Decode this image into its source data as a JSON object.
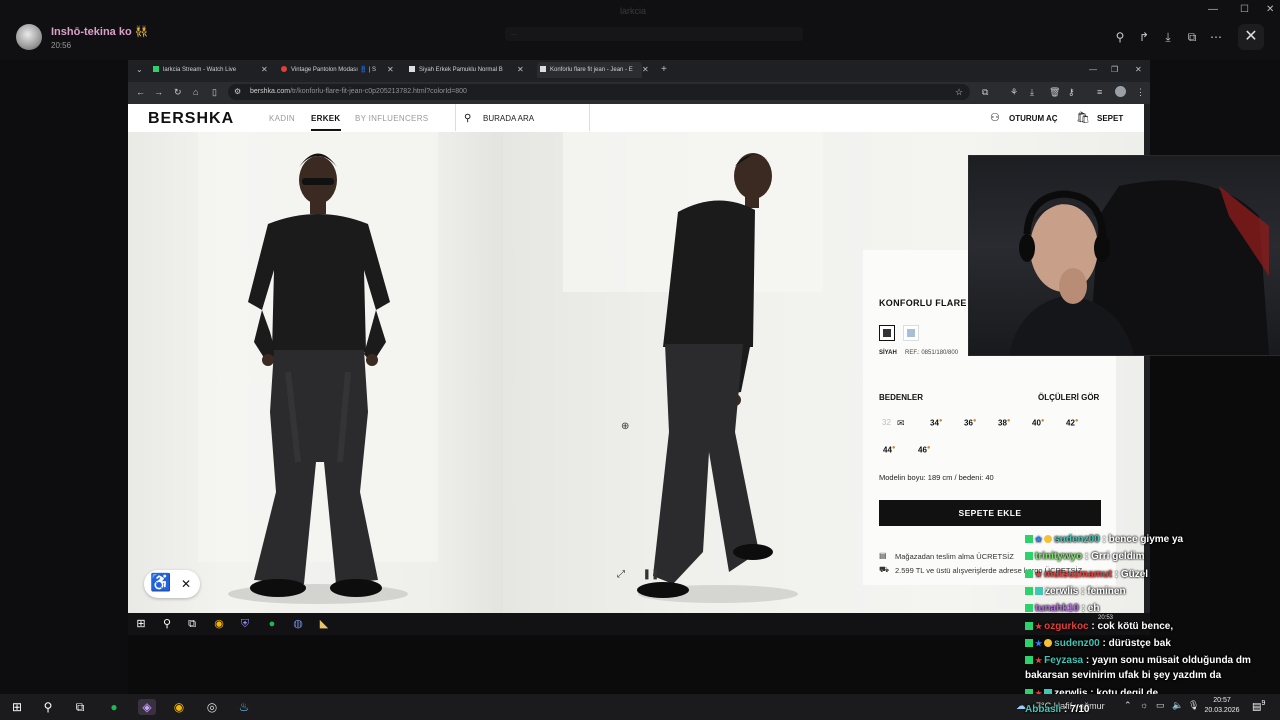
{
  "viewer": {
    "username": "Inshō-tekina ko 👯",
    "time": "20:56",
    "window_title": "larkcia",
    "notice": "..."
  },
  "browser": {
    "tabs": [
      {
        "label": "larkcia Stream - Watch Live",
        "favicon_color": "#2bd36a",
        "icon": "kick-icon"
      },
      {
        "label": "Vintage Pantolon Modası 👖 | S",
        "favicon_color": "#e0403a",
        "icon": "pinterest-icon"
      },
      {
        "label": "Siyah Erkek Pamuklu Normal B",
        "favicon_color": "#111111",
        "icon": "bershka-icon"
      },
      {
        "label": "Konforlu flare fit jean - Jean - E",
        "favicon_color": "#111111",
        "icon": "bershka-icon"
      }
    ],
    "url_domain": "bershka.com",
    "url_path": "/tr/konforlu-flare-fit-jean-c0p205213782.html?colorId=800"
  },
  "site": {
    "logo": "BERSHKA",
    "nav": [
      "KADIN",
      "ERKEK",
      "BY INFLUENCERS"
    ],
    "search_placeholder": "BURADA ARA",
    "login": "OTURUM AÇ",
    "cart": "SEPET"
  },
  "product": {
    "title": "KONFORLU FLARE",
    "color_name": "SİYAH",
    "ref": "REF.: 0851/180/800",
    "sizes_label": "BEDENLER",
    "size_guide": "ÖLÇÜLERİ GÖR",
    "sizes": [
      "32",
      "34",
      "36",
      "38",
      "40",
      "42",
      "44",
      "46"
    ],
    "model_info": "Modelin boyu: 189 cm / bedeni: 40",
    "add_to_cart": "SEPETE EKLE",
    "shipping_1": "Mağazadan teslim alma ÜCRETSİZ",
    "shipping_2": "2.599 TL ve üstü alışverişlerde adrese kargo ÜCRETSİZ"
  },
  "chat": [
    {
      "user": "sudenz00",
      "message": "bence giyme ya",
      "user_color": "#3fc6b5"
    },
    {
      "user": "trinitywyo",
      "message": "Grri geldim",
      "user_color": "#7be06a"
    },
    {
      "user": "mutsuzmamut",
      "message": "Güzel",
      "user_color": "#e0403a"
    },
    {
      "user": "zerwlis",
      "message": "feminen",
      "user_color": "#ffffff"
    },
    {
      "user": "tunahk10",
      "message": "eh",
      "user_color": "#b06be0"
    },
    {
      "user": "ozgurkoc",
      "message": "cok kötü bence,",
      "user_color": "#e0403a"
    },
    {
      "user": "sudenz00",
      "message": "dürüstçe bak",
      "user_color": "#3fc6b5"
    },
    {
      "user": "Feyzasa",
      "message": "yayın sonu müsait olduğunda dm",
      "user_color": "#3fc6b5"
    },
    {
      "user": "",
      "message": "bakarsan sevinirim ufak bi şey yazdım da",
      "user_color": "#ffffff"
    },
    {
      "user": "zerwlis",
      "message": "kotu degil de",
      "user_color": "#ffffff"
    },
    {
      "user": "Abbasli",
      "message": "7/10",
      "user_color": "#3fc6b5"
    }
  ],
  "taskbar": {
    "weather": "7°C  Hafif yağmur",
    "time": "20:57",
    "date": "20.03.2026",
    "inner_time": "20:53",
    "notifications": "9"
  }
}
